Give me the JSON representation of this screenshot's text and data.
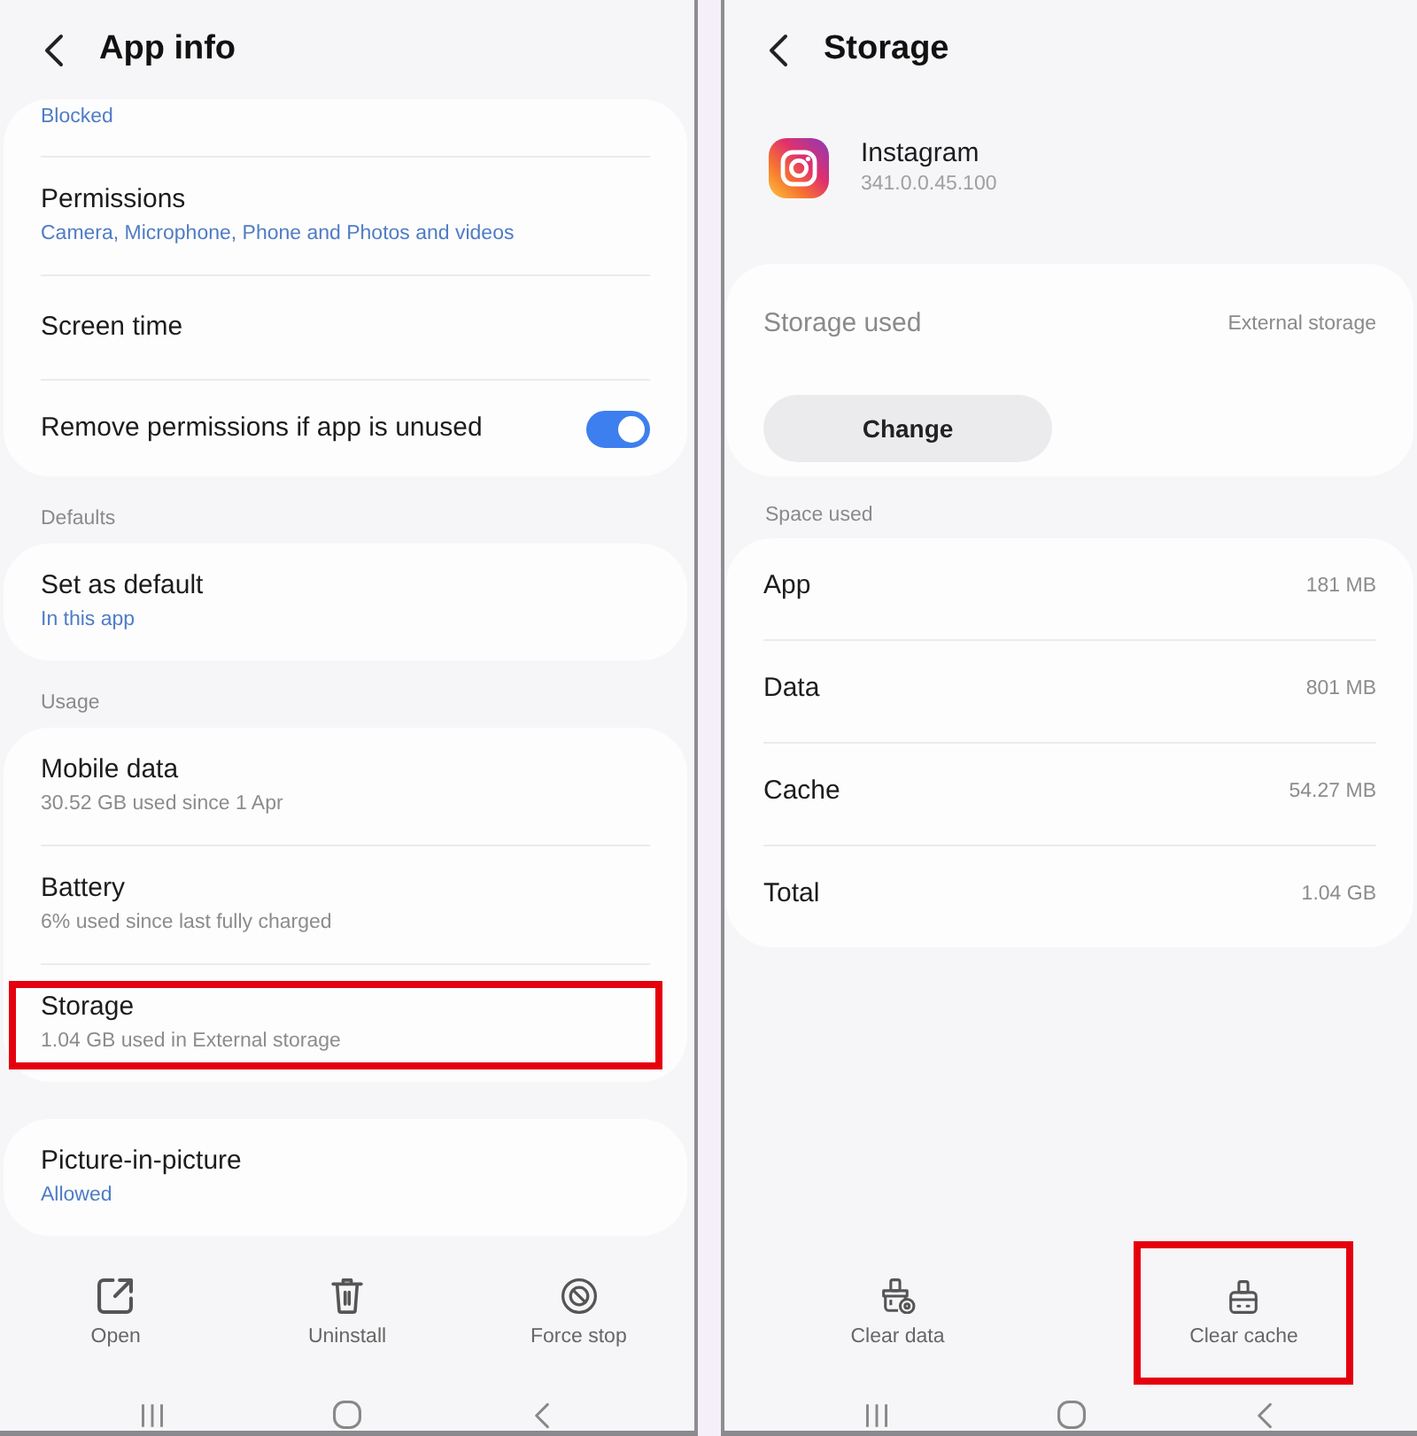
{
  "app_info_screen": {
    "title": "App info",
    "sections": [
      {
        "items": [
          {
            "kind": "value",
            "subtitle": "Blocked",
            "highlighted": false
          },
          {
            "kind": "value",
            "title": "Permissions",
            "subtitle": "Camera, Microphone, Phone and Photos and videos",
            "highlighted": false
          },
          {
            "kind": "value",
            "title": "Screen time",
            "highlighted": false
          },
          {
            "kind": "switch",
            "title": "Remove permissions if app is unused",
            "on": true,
            "highlighted": false
          }
        ]
      },
      {
        "header": "Defaults",
        "items": [
          {
            "kind": "value",
            "title": "Set as default",
            "subtitle": "In this app",
            "highlighted": false
          }
        ]
      },
      {
        "header": "Usage",
        "items": [
          {
            "kind": "usage",
            "title": "Mobile data",
            "subtitle": "30.52 GB used since 1 Apr",
            "highlighted": false
          },
          {
            "kind": "usage",
            "title": "Battery",
            "subtitle": "6% used since last fully charged",
            "highlighted": false
          },
          {
            "kind": "usage",
            "title": "Storage",
            "subtitle": "1.04 GB used in External storage",
            "highlighted": true
          }
        ]
      },
      {
        "items": [
          {
            "kind": "value",
            "title": "Picture-in-picture",
            "subtitle": "Allowed",
            "highlighted": false
          }
        ]
      }
    ],
    "actions": [
      {
        "kind": "open",
        "label": "Open"
      },
      {
        "kind": "uninstall",
        "label": "Uninstall"
      },
      {
        "kind": "stop",
        "label": "Force stop"
      }
    ]
  },
  "storage_screen": {
    "title": "Storage",
    "app": {
      "name": "Instagram",
      "version": "341.0.0.45.100"
    },
    "storage_location": {
      "label": "Storage used",
      "value": "External storage",
      "button": "Change"
    },
    "space_used": {
      "header": "Space used",
      "rows": [
        {
          "label": "App",
          "value": "181 MB"
        },
        {
          "label": "Data",
          "value": "801 MB"
        },
        {
          "label": "Cache",
          "value": "54.27 MB"
        },
        {
          "label": "Total",
          "value": "1.04 GB"
        }
      ]
    },
    "actions": [
      {
        "kind": "data",
        "label": "Clear data",
        "highlighted": false
      },
      {
        "kind": "cache",
        "label": "Clear cache",
        "highlighted": true
      }
    ]
  }
}
